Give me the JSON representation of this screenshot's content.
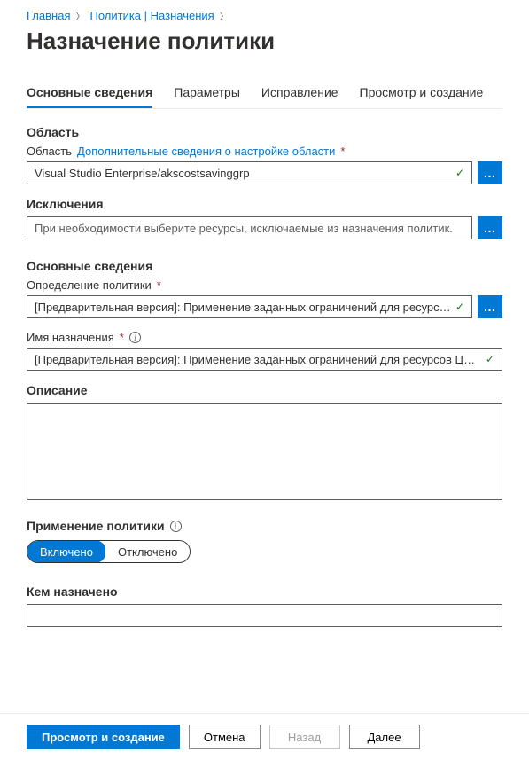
{
  "breadcrumb": {
    "home": "Главная",
    "policy": "Политика | Назначения"
  },
  "page_title": "Назначение политики",
  "tabs": {
    "basics": "Основные сведения",
    "parameters": "Параметры",
    "remediation": "Исправление",
    "review": "Просмотр и создание"
  },
  "scope": {
    "heading": "Область",
    "label": "Область",
    "help_link": "Дополнительные сведения о настройке области",
    "value": "Visual Studio Enterprise/akscostsavinggrp"
  },
  "exclusions": {
    "label": "Исключения",
    "placeholder": "При необходимости выберите ресурсы, исключаемые из назначения политик."
  },
  "basics": {
    "heading": "Основные сведения",
    "definition_label": "Определение политики",
    "definition_value": "[Предварительная версия]: Применение заданных ограничений для ресурс…",
    "name_label": "Имя назначения",
    "name_value": "[Предварительная версия]: Применение заданных ограничений для ресурсов Ц…",
    "description_label": "Описание",
    "description_value": ""
  },
  "enforcement": {
    "label": "Применение политики",
    "enabled": "Включено",
    "disabled": "Отключено"
  },
  "assigned_by": {
    "label": "Кем назначено",
    "value": ""
  },
  "footer": {
    "review": "Просмотр и создание",
    "cancel": "Отмена",
    "back": "Назад",
    "next": "Далее"
  }
}
